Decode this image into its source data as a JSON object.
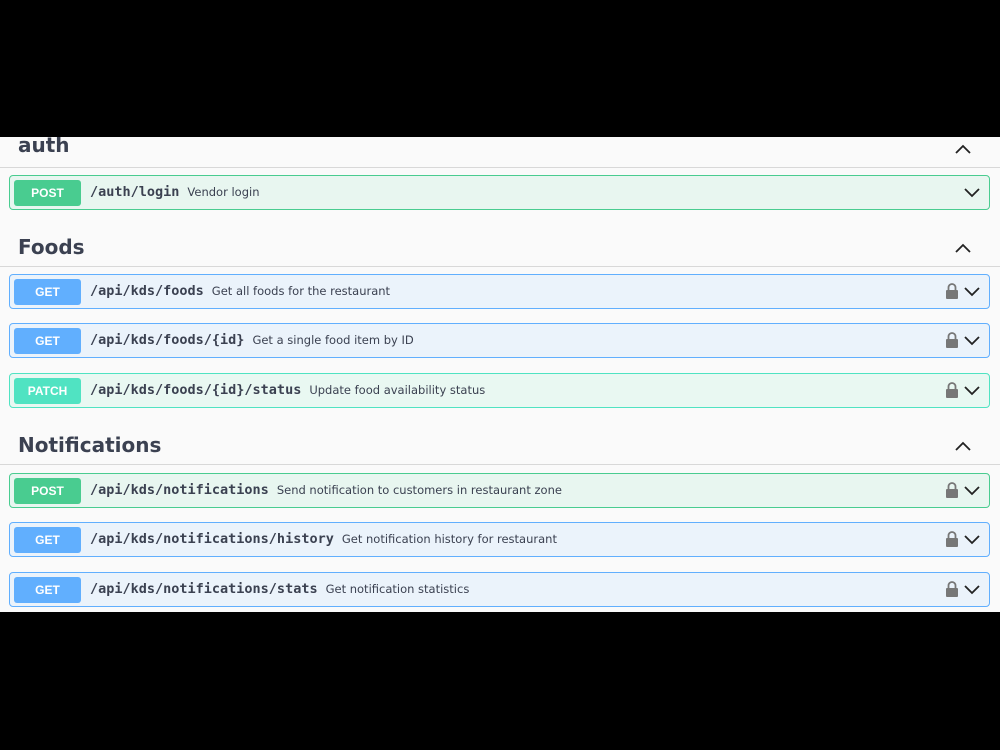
{
  "colors": {
    "post": "#49cc90",
    "get": "#61affe",
    "patch": "#50e3c2",
    "text": "#3b4151"
  },
  "sections": [
    {
      "title": "auth",
      "operations": [
        {
          "method": "POST",
          "path": "/auth/login",
          "summary": "Vendor login",
          "locked": false
        }
      ]
    },
    {
      "title": "Foods",
      "operations": [
        {
          "method": "GET",
          "path": "/api/kds/foods",
          "summary": "Get all foods for the restaurant",
          "locked": true
        },
        {
          "method": "GET",
          "path": "/api/kds/foods/{id}",
          "summary": "Get a single food item by ID",
          "locked": true
        },
        {
          "method": "PATCH",
          "path": "/api/kds/foods/{id}/status",
          "summary": "Update food availability status",
          "locked": true
        }
      ]
    },
    {
      "title": "Notifications",
      "operations": [
        {
          "method": "POST",
          "path": "/api/kds/notifications",
          "summary": "Send notification to customers in restaurant zone",
          "locked": true
        },
        {
          "method": "GET",
          "path": "/api/kds/notifications/history",
          "summary": "Get notification history for restaurant",
          "locked": true
        },
        {
          "method": "GET",
          "path": "/api/kds/notifications/stats",
          "summary": "Get notification statistics",
          "locked": true
        }
      ]
    }
  ]
}
